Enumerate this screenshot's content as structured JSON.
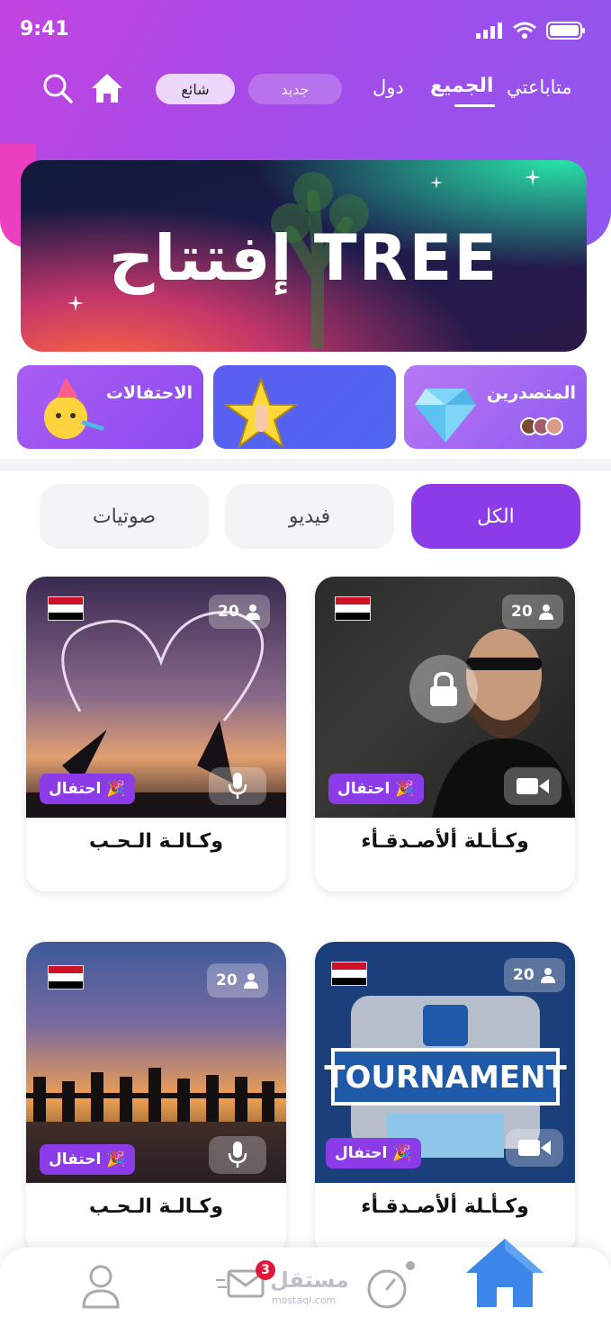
{
  "status_bar": {
    "time": "9:41"
  },
  "header": {
    "tabs": [
      {
        "label": "متاباعتي"
      },
      {
        "label": "الجميع"
      },
      {
        "label": "دول"
      }
    ],
    "pills": [
      {
        "label": "جديد"
      },
      {
        "label": "شائع"
      }
    ]
  },
  "banner": {
    "title": "إفتتاح TREE"
  },
  "categories": [
    {
      "label": "المتصدرين"
    },
    {
      "label": ""
    },
    {
      "label": "الاحتفالات"
    }
  ],
  "filters": [
    {
      "label": "الكل"
    },
    {
      "label": "فيديو"
    },
    {
      "label": "صوتيات"
    }
  ],
  "rooms": [
    {
      "name": "وكـأـلة ألأصـدقـأء",
      "count": "20",
      "badge": "احتفال",
      "media": "video-icon",
      "locked": true
    },
    {
      "name": "وكـالـة الـحـب",
      "count": "20",
      "badge": "احتفال",
      "media": "mic-icon",
      "locked": false
    },
    {
      "name": "وكـأـلة ألأصـدقـأء",
      "count": "20",
      "badge": "احتفال",
      "media": "video-icon",
      "locked": false
    },
    {
      "name": "وكـالـة الـحـب",
      "count": "20",
      "badge": "احتفال",
      "media": "mic-icon",
      "locked": false
    }
  ],
  "bottom_nav": {
    "messages_badge": "3",
    "watermark": "مستقل",
    "watermark_sub": "mostaql.com"
  },
  "colors": {
    "primary": "#8b3be8",
    "accent_pink": "#ea3fbf",
    "flag_red": "#ce1126"
  }
}
